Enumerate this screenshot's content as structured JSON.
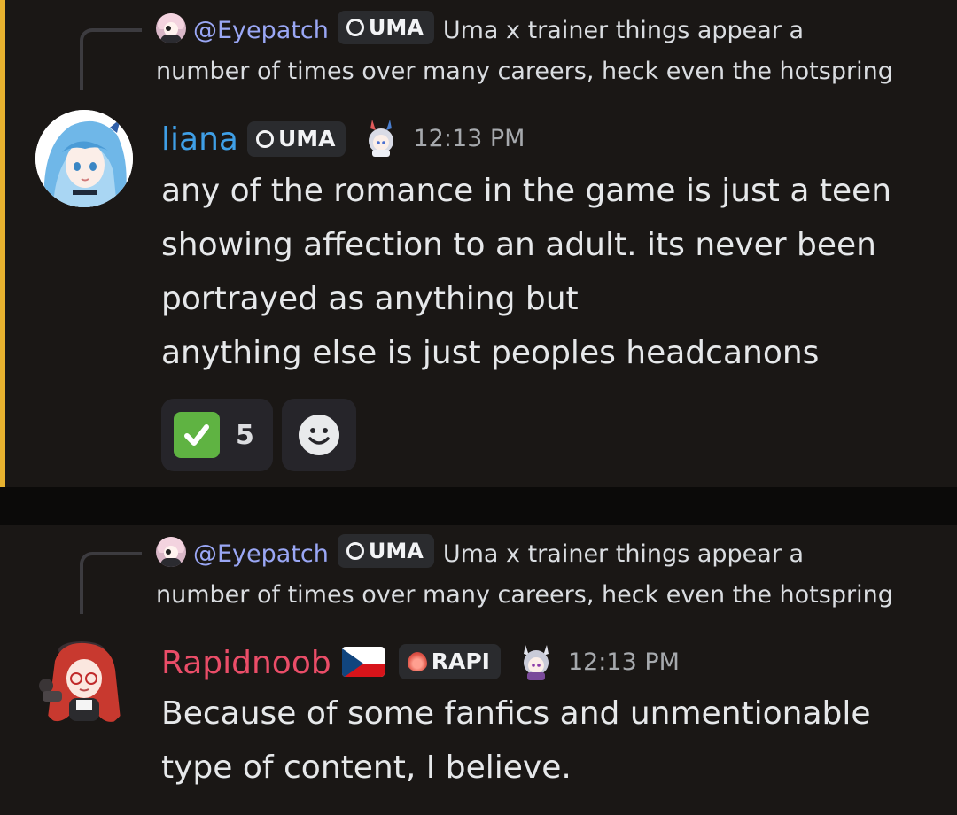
{
  "messages": [
    {
      "reply": {
        "mention": "@Eyepatch",
        "tag": "UMA",
        "text_line1": "Uma x trainer things appear a",
        "text_line2": "number of times over many careers, heck even the hotspring"
      },
      "author": "liana",
      "author_color": "#3f9fe6",
      "tag": "UMA",
      "time": "12:13 PM",
      "lines": [
        "any of the romance in the game is just a teen",
        "showing affection to an adult. its never been",
        "portrayed as anything but",
        "anything else is just peoples headcanons"
      ],
      "reactions": [
        {
          "icon": "white-check-mark",
          "count": "5"
        }
      ]
    },
    {
      "reply": {
        "mention": "@Eyepatch",
        "tag": "UMA",
        "text_line1": "Uma x trainer things appear a",
        "text_line2": "number of times over many careers, heck even the hotspring"
      },
      "author": "Rapidnoob",
      "author_color": "#ea4d68",
      "flag": "czech-flag",
      "tag": "RAPI",
      "time": "12:13 PM",
      "lines": [
        "Because of some fanfics and unmentionable",
        "type of content, I believe."
      ]
    }
  ],
  "colors": {
    "background": "#1a1715",
    "highlight_bar": "#e7b22f",
    "mention": "#9aa7f5",
    "reaction_check": "#5fb342"
  }
}
